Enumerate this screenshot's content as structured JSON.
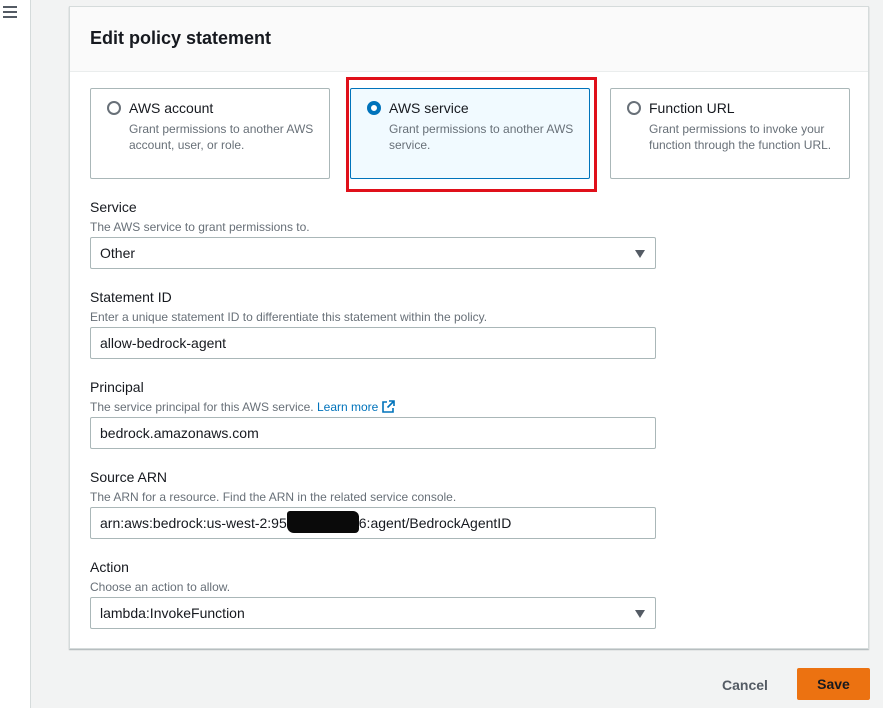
{
  "dialog": {
    "title": "Edit policy statement"
  },
  "principal_types": [
    {
      "label": "AWS account",
      "description": "Grant permissions to another AWS account, user, or role.",
      "selected": false
    },
    {
      "label": "AWS service",
      "description": "Grant permissions to another AWS service.",
      "selected": true
    },
    {
      "label": "Function URL",
      "description": "Grant permissions to invoke your function through the function URL.",
      "selected": false
    }
  ],
  "service": {
    "label": "Service",
    "description": "The AWS service to grant permissions to.",
    "value": "Other"
  },
  "statement_id": {
    "label": "Statement ID",
    "description": "Enter a unique statement ID to differentiate this statement within the policy.",
    "value": "allow-bedrock-agent"
  },
  "principal": {
    "label": "Principal",
    "description": "The service principal for this AWS service.",
    "learn_more": "Learn more",
    "value": "bedrock.amazonaws.com"
  },
  "source_arn": {
    "label": "Source ARN",
    "description": "The ARN for a resource. Find the ARN in the related service console.",
    "value_prefix": "arn:aws:bedrock:us-west-2:95",
    "value_suffix": "6:agent/BedrockAgentID"
  },
  "action": {
    "label": "Action",
    "description": "Choose an action to allow.",
    "value": "lambda:InvokeFunction"
  },
  "footer": {
    "cancel_label": "Cancel",
    "save_label": "Save"
  },
  "colors": {
    "primary_button": "#ec7211",
    "selected_tile": "#0073bb",
    "highlight_box": "#e0101a",
    "link": "#0073bb"
  },
  "icons": {
    "menu": "hamburger-menu-icon",
    "external_link": "external-link-icon",
    "dropdown": "caret-down-icon"
  }
}
